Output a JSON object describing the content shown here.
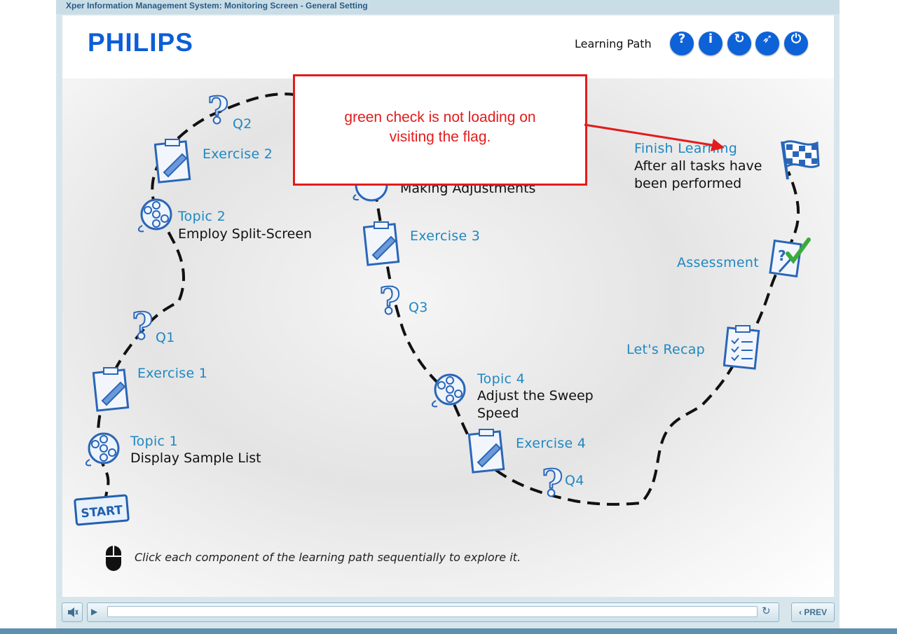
{
  "window": {
    "title": "Xper Information Management System: Monitoring Screen - General Setting"
  },
  "header": {
    "logo_text": "PHILIPS",
    "section_label": "Learning Path",
    "buttons": [
      {
        "name": "help",
        "glyph": "?"
      },
      {
        "name": "info",
        "glyph": "i"
      },
      {
        "name": "replay",
        "glyph": "↻"
      },
      {
        "name": "compass",
        "glyph": "➶"
      },
      {
        "name": "power",
        "glyph": "⏻"
      }
    ]
  },
  "path": {
    "start": "START",
    "topic1": {
      "title": "Topic 1",
      "subtitle": "Display Sample List"
    },
    "exercise1": "Exercise 1",
    "q1": "Q1",
    "topic2": {
      "title": "Topic 2",
      "subtitle": "Employ Split-Screen"
    },
    "exercise2": "Exercise 2",
    "q2": "Q2",
    "topic3": {
      "subtitle": "Making Adjustments"
    },
    "exercise3": "Exercise 3",
    "q3": "Q3",
    "topic4": {
      "title": "Topic 4",
      "subtitle_line1": "Adjust the Sweep",
      "subtitle_line2": "Speed"
    },
    "exercise4": "Exercise 4",
    "q4": "Q4",
    "recap": "Let's Recap",
    "assessment": "Assessment",
    "finish": {
      "title": "Finish Learning",
      "subtitle_line1": "After all tasks have",
      "subtitle_line2": "been performed"
    }
  },
  "annotation": {
    "line1": "green check is not loading on",
    "line2": "visiting the flag.",
    "color": "#e41b1b"
  },
  "instruction": "Click each component of the learning path sequentially to explore it.",
  "controls": {
    "prev_label": "PREV",
    "progress": 0
  },
  "colors": {
    "accent": "#1f88c2",
    "brand": "#0b5ed7",
    "frame": "#d8e6ec"
  }
}
